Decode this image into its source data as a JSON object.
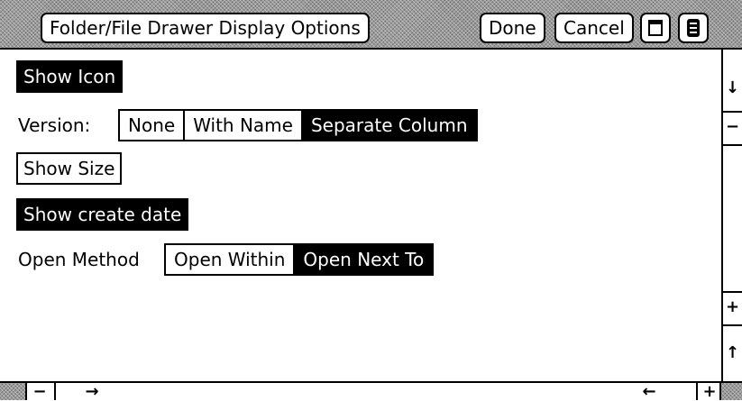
{
  "window": {
    "title": "Folder/File Drawer Display Options",
    "done_label": "Done",
    "cancel_label": "Cancel"
  },
  "options": {
    "show_icon": {
      "label": "Show Icon",
      "selected": true
    },
    "version": {
      "label": "Version:",
      "choices": [
        {
          "label": "None",
          "selected": false
        },
        {
          "label": "With Name",
          "selected": false
        },
        {
          "label": "Separate Column",
          "selected": true
        }
      ]
    },
    "show_size": {
      "label": "Show Size",
      "selected": false
    },
    "show_create_date": {
      "label": "Show create date",
      "selected": true
    },
    "open_method": {
      "label": "Open Method",
      "choices": [
        {
          "label": "Open Within",
          "selected": false
        },
        {
          "label": "Open Next To",
          "selected": true
        }
      ]
    }
  },
  "vscroll": {
    "up_arrow": "↓",
    "minus": "−",
    "plus": "+",
    "down_arrow": "↑"
  },
  "hscroll": {
    "minus": "−",
    "right_arrow": "→",
    "left_arrow": "←",
    "plus": "+"
  },
  "icons": {
    "window": "window-icon",
    "menu": "menu-icon"
  }
}
